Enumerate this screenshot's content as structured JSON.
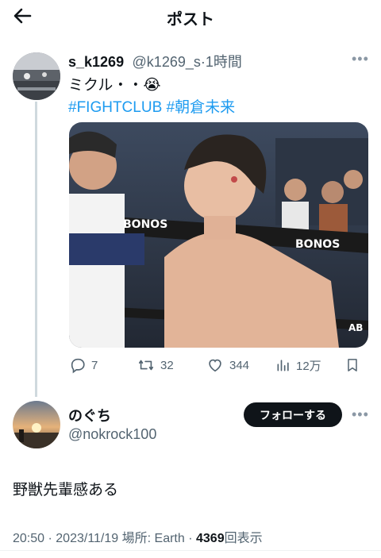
{
  "header": {
    "title": "ポスト"
  },
  "original_post": {
    "display_name": "s_k1269",
    "handle": "@k1269_s",
    "separator": "·",
    "time": "1時間",
    "text": "ミクル・・😭",
    "hashtags": [
      "#FIGHTCLUB",
      "#朝倉未来"
    ],
    "image_overlay": {
      "banner_text_1": "BONOS",
      "banner_text_2": "BONOS",
      "corner_text": "AB"
    },
    "actions": {
      "replies": "7",
      "reposts": "32",
      "likes": "344",
      "views": "12万"
    }
  },
  "reply_post": {
    "display_name": "のぐち",
    "handle": "@nokrock100",
    "follow_label": "フォローする",
    "text": "野獣先輩感ある",
    "footer": {
      "time": "20:50",
      "sep1": "·",
      "date": "2023/11/19",
      "location": "場所: Earth",
      "sep2": "·",
      "views": "4369",
      "views_label": "回表示"
    }
  },
  "icons": [
    "back-arrow-icon",
    "more-icon",
    "reply-icon",
    "repost-icon",
    "like-icon",
    "views-icon",
    "bookmark-icon"
  ],
  "colors": {
    "link": "#1d9bf0",
    "text": "#0f1419",
    "muted": "#536471",
    "button": "#0f1419"
  }
}
